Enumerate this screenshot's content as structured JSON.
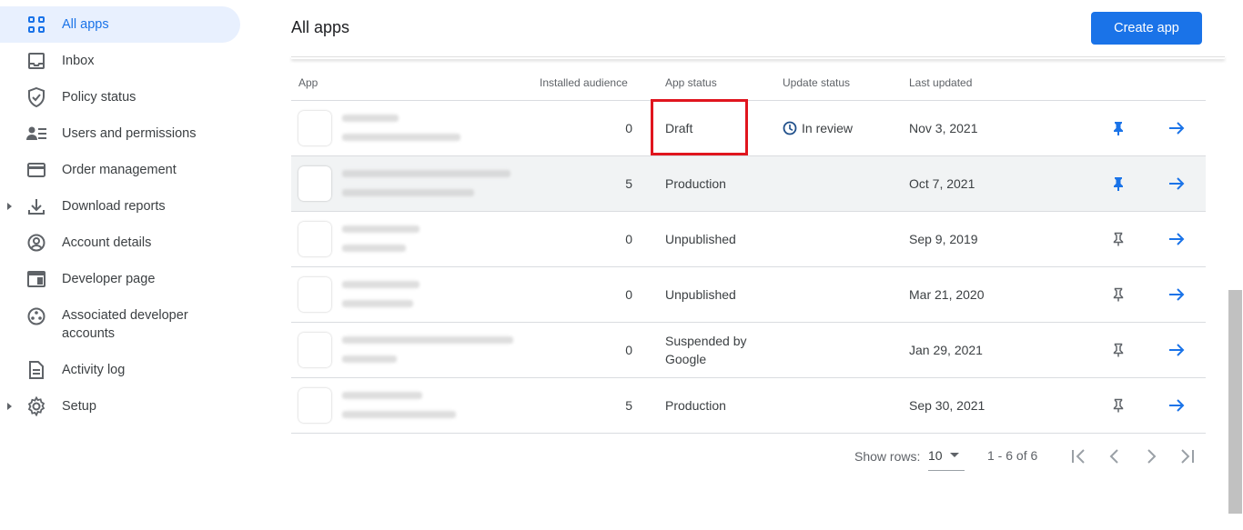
{
  "sidebar": {
    "items": [
      {
        "label": "All apps",
        "icon": "apps-grid-icon"
      },
      {
        "label": "Inbox",
        "icon": "inbox-icon"
      },
      {
        "label": "Policy status",
        "icon": "shield-check-icon"
      },
      {
        "label": "Users and permissions",
        "icon": "users-icon"
      },
      {
        "label": "Order management",
        "icon": "credit-card-icon"
      },
      {
        "label": "Download reports",
        "icon": "download-icon"
      },
      {
        "label": "Account details",
        "icon": "account-circle-icon"
      },
      {
        "label": "Developer page",
        "icon": "web-page-icon"
      },
      {
        "label": "Associated developer accounts",
        "icon": "linked-accounts-icon"
      },
      {
        "label": "Activity log",
        "icon": "document-icon"
      },
      {
        "label": "Setup",
        "icon": "gear-icon"
      }
    ]
  },
  "header": {
    "title": "All apps",
    "create_label": "Create app"
  },
  "table": {
    "columns": [
      "App",
      "Installed audience",
      "App status",
      "Update status",
      "Last updated"
    ],
    "rows": [
      {
        "audience": "0",
        "status": "Draft",
        "update": "In review",
        "updated": "Nov 3, 2021",
        "pinned": true
      },
      {
        "audience": "5",
        "status": "Production",
        "update": "",
        "updated": "Oct 7, 2021",
        "pinned": true
      },
      {
        "audience": "0",
        "status": "Unpublished",
        "update": "",
        "updated": "Sep 9, 2019",
        "pinned": false
      },
      {
        "audience": "0",
        "status": "Unpublished",
        "update": "",
        "updated": "Mar 21, 2020",
        "pinned": false
      },
      {
        "audience": "0",
        "status": "Suspended by Google",
        "update": "",
        "updated": "Jan 29, 2021",
        "pinned": false
      },
      {
        "audience": "5",
        "status": "Production",
        "update": "",
        "updated": "Sep 30, 2021",
        "pinned": false
      }
    ]
  },
  "footer": {
    "show_rows_label": "Show rows:",
    "rows_value": "10",
    "range": "1 - 6 of 6"
  },
  "colors": {
    "accent": "#1a73e8",
    "highlight_box": "#e0151e"
  }
}
